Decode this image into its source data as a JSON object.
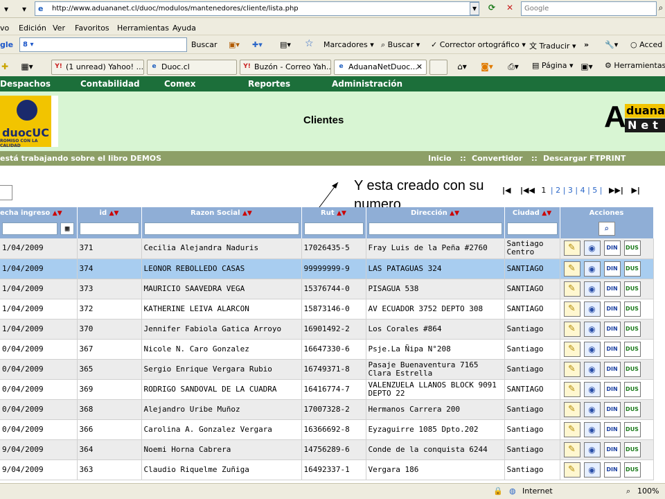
{
  "browser": {
    "url": "http://www.aduananet.cl/duoc/modulos/mantenedores/cliente/lista.php",
    "search_placeholder": "Google",
    "menu": [
      "vo",
      "Edición",
      "Ver",
      "Favoritos",
      "Herramientas",
      "Ayuda"
    ],
    "google_toolbar": {
      "brand": "gle",
      "buscar": "Buscar",
      "marcadores": "Marcadores",
      "buscar2": "Buscar",
      "corrector": "Corrector ortográfico",
      "traducir": "Traducir",
      "acceder": "Acced"
    },
    "tabs": [
      {
        "label": "(1 unread) Yahoo! ...",
        "favicon": "Y!"
      },
      {
        "label": "Duoc.cl",
        "favicon": "e"
      },
      {
        "label": "Buzón - Correo Yah...",
        "favicon": "Y!"
      },
      {
        "label": "AduanaNetDuoc...",
        "favicon": "e"
      }
    ],
    "command_bar": {
      "pagina": "Página",
      "herramientas": "Herramientas"
    },
    "status": {
      "zone": "Internet",
      "zoom": "100%"
    }
  },
  "nav": [
    "Despachos",
    "Contabilidad",
    "Comex",
    "Reportes",
    "Administración"
  ],
  "header": {
    "title": "Clientes",
    "logo_left": "duocUC",
    "logo_left_tagline": "ROMISO CON LA CALIDAD",
    "logo_right_a": "A",
    "logo_right_top": "duana",
    "logo_right_bottom": "Net"
  },
  "infobar": {
    "left": "está trabajando sobre el libro DEMOS",
    "links": [
      "Inicio",
      "Convertidor",
      "Descargar FTPRINT"
    ],
    "sep": "::"
  },
  "annotation": "Y esta creado con su numero",
  "pagination": [
    "1",
    "2",
    "3",
    "4",
    "5"
  ],
  "columns": [
    "echa ingreso",
    "id",
    "Razon Social",
    "Rut",
    "Dirección",
    "Ciudad",
    "Acciones"
  ],
  "action_labels": {
    "din": "DIN",
    "dus": "DUS"
  },
  "rows": [
    {
      "fecha": "1/04/2009",
      "id": "371",
      "razon": "Cecilia Alejandra Naduris",
      "rut": "17026435-5",
      "dir": "Fray Luis de la Peña #2760",
      "ciudad": "Santiago Centro"
    },
    {
      "fecha": "1/04/2009",
      "id": "374",
      "razon": "LEONOR REBOLLEDO CASAS",
      "rut": "99999999-9",
      "dir": "LAS PATAGUAS 324",
      "ciudad": "SANTIAGO"
    },
    {
      "fecha": "1/04/2009",
      "id": "373",
      "razon": "MAURICIO SAAVEDRA VEGA",
      "rut": "15376744-0",
      "dir": "PISAGUA 538",
      "ciudad": "SANTIAGO"
    },
    {
      "fecha": "1/04/2009",
      "id": "372",
      "razon": "KATHERINE LEIVA ALARCON",
      "rut": "15873146-0",
      "dir": "AV ECUADOR 3752 DEPTO 308",
      "ciudad": "SANTIAGO"
    },
    {
      "fecha": "1/04/2009",
      "id": "370",
      "razon": "Jennifer Fabiola Gatica Arroyo",
      "rut": "16901492-2",
      "dir": "Los Corales #864",
      "ciudad": "Santiago"
    },
    {
      "fecha": "0/04/2009",
      "id": "367",
      "razon": "Nicole N. Caro Gonzalez",
      "rut": "16647330-6",
      "dir": "Psje.La Ñipa N°208",
      "ciudad": "Santiago"
    },
    {
      "fecha": "0/04/2009",
      "id": "365",
      "razon": "Sergio Enrique Vergara Rubio",
      "rut": "16749371-8",
      "dir": "Pasaje Buenaventura 7165 Clara Estrella",
      "ciudad": "Santiago"
    },
    {
      "fecha": "0/04/2009",
      "id": "369",
      "razon": "RODRIGO SANDOVAL DE LA CUADRA",
      "rut": "16416774-7",
      "dir": "VALENZUELA LLANOS BLOCK 9091 DEPTO 22",
      "ciudad": "SANTIAGO"
    },
    {
      "fecha": "0/04/2009",
      "id": "368",
      "razon": "Alejandro Uribe Muñoz",
      "rut": "17007328-2",
      "dir": "Hermanos Carrera 200",
      "ciudad": "Santiago"
    },
    {
      "fecha": "0/04/2009",
      "id": "366",
      "razon": "Carolina A. Gonzalez Vergara",
      "rut": "16366692-8",
      "dir": "Eyzaguirre 1085 Dpto.202",
      "ciudad": "Santiago"
    },
    {
      "fecha": "9/04/2009",
      "id": "364",
      "razon": "Noemi Horna Cabrera",
      "rut": "14756289-6",
      "dir": "Conde de la conquista 6244",
      "ciudad": "Santiago"
    },
    {
      "fecha": "9/04/2009",
      "id": "363",
      "razon": "Claudio Riquelme Zuñiga",
      "rut": "16492337-1",
      "dir": "Vergara 186",
      "ciudad": "Santiago"
    }
  ],
  "selected_row_index": 1,
  "colors": {
    "nav": "#1c6f3a",
    "header": "#d8f5d3",
    "infobar": "#8d9f67",
    "table_header": "#8faed6",
    "selected": "#a8cdf0"
  }
}
